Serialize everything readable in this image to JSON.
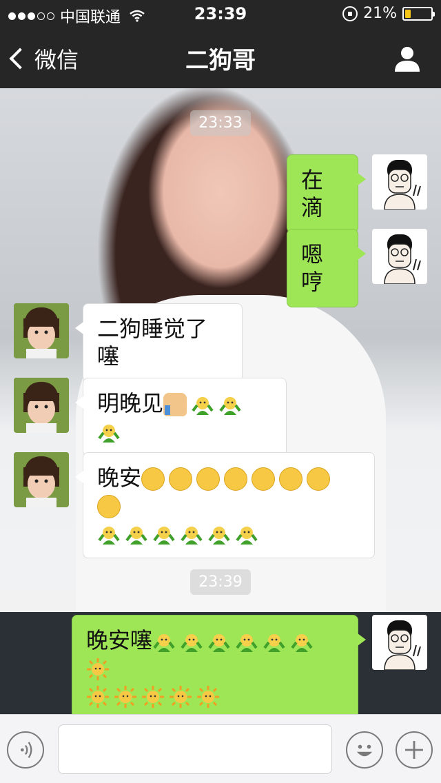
{
  "status_bar": {
    "carrier": "中国联通",
    "time": "23:39",
    "battery_percent": "21%",
    "battery_level": 0.21,
    "signal_bars_filled": 3,
    "signal_bars_total": 5,
    "icons": [
      "signal-dots-icon",
      "wifi-icon",
      "rotation-lock-icon",
      "battery-icon"
    ],
    "battery_color": "#f5c518"
  },
  "nav": {
    "back_label": "微信",
    "title": "二狗哥",
    "icons": [
      "chevron-left-icon",
      "person-icon"
    ]
  },
  "chat": {
    "timestamps": [
      "23:33",
      "23:39"
    ],
    "messages": [
      {
        "side": "sent",
        "text": "在滴",
        "emoji": []
      },
      {
        "side": "sent",
        "text": "嗯哼",
        "emoji": []
      },
      {
        "side": "received",
        "text": "二狗睡觉了噻",
        "emoji": []
      },
      {
        "side": "received",
        "text": "明晚见",
        "emoji": [
          "thumbs-up-icon",
          "sprout-icon",
          "sprout-icon",
          "sprout-icon"
        ]
      },
      {
        "side": "received",
        "text": "晚安",
        "emoji": [
          "kiss-icon",
          "kiss-icon",
          "kiss-icon",
          "kiss-icon",
          "kiss-icon",
          "kiss-icon",
          "kiss-icon",
          "kiss-icon",
          "sprout-icon",
          "sprout-icon",
          "sprout-icon",
          "sprout-icon",
          "sprout-icon",
          "sprout-icon"
        ]
      },
      {
        "side": "sent",
        "text": "晚安噻",
        "emoji": [
          "sprout-icon",
          "sprout-icon",
          "sprout-icon",
          "sprout-icon",
          "sprout-icon",
          "sprout-icon",
          "sun-icon",
          "sun-icon",
          "sun-icon",
          "sun-icon",
          "sun-icon",
          "sun-icon"
        ]
      }
    ],
    "colors": {
      "sent_bubble": "#9fe657",
      "received_bubble": "#ffffff"
    }
  },
  "input_bar": {
    "value": "",
    "icons": [
      "voice-icon",
      "emoji-icon",
      "plus-icon"
    ]
  }
}
